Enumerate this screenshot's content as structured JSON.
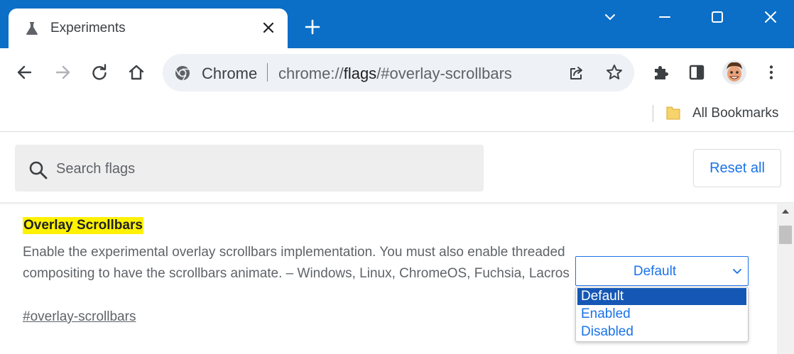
{
  "tab": {
    "title": "Experiments"
  },
  "omnibox": {
    "scheme_label": "Chrome",
    "url_prefix": "chrome://",
    "url_host": "flags",
    "url_suffix": "/#overlay-scrollbars"
  },
  "bookmarks": {
    "all_label": "All Bookmarks"
  },
  "search": {
    "placeholder": "Search flags",
    "value": ""
  },
  "reset_label": "Reset all",
  "flag": {
    "title": "Overlay Scrollbars",
    "description": "Enable the experimental overlay scrollbars implementation. You must also enable threaded compositing to have the scrollbars animate. – Windows, Linux, ChromeOS, Fuchsia, Lacros",
    "link": "#overlay-scrollbars",
    "select_value": "Default",
    "options": [
      "Default",
      "Enabled",
      "Disabled"
    ],
    "selected_option": "Default"
  },
  "colors": {
    "titlebar": "#0b6fc7",
    "accent": "#1a73e8",
    "highlight": "#fff200",
    "option_selected_bg": "#1557b5"
  },
  "icons": {
    "tab": "flask-icon",
    "tab_close": "close-icon",
    "new_tab": "plus-icon",
    "window": [
      "chevron-down-icon",
      "minimize-icon",
      "maximize-icon",
      "close-window-icon"
    ],
    "toolbar": [
      "back-arrow-icon",
      "forward-arrow-icon",
      "reload-icon",
      "home-icon",
      "chrome-logo-icon",
      "share-icon",
      "star-icon",
      "extensions-icon",
      "side-panel-icon",
      "avatar",
      "menu-kebab-icon"
    ],
    "bookmark_folder": "folder-icon",
    "search": "search-icon",
    "select": "chevron-down-icon"
  }
}
